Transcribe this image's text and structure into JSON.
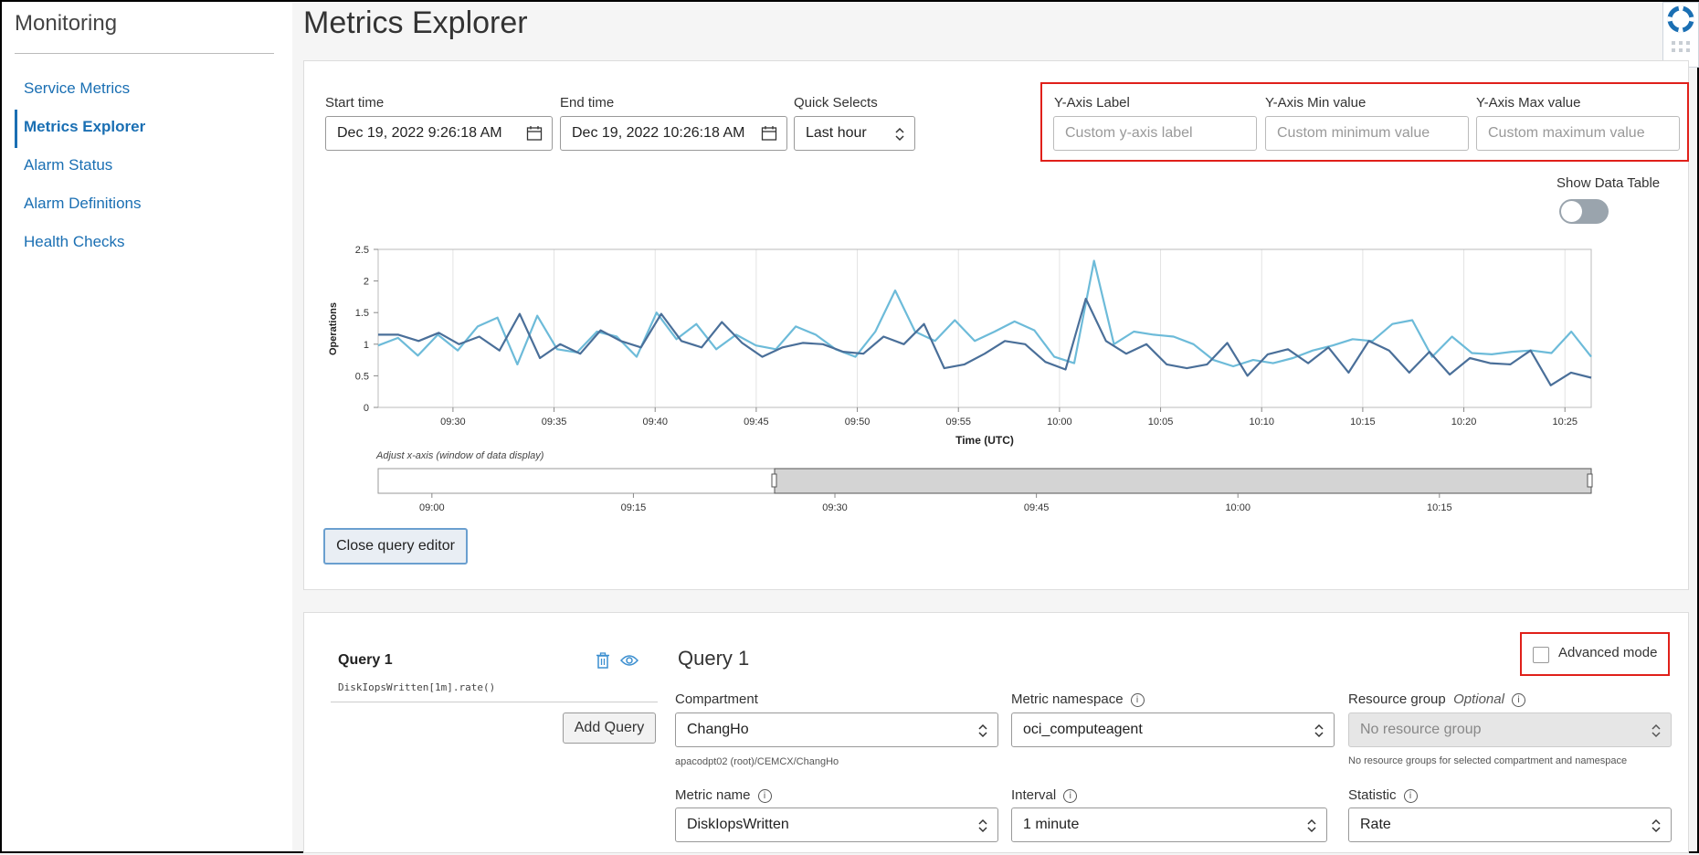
{
  "sidebar": {
    "title": "Monitoring",
    "items": [
      {
        "label": "Service Metrics",
        "active": false
      },
      {
        "label": "Metrics Explorer",
        "active": true
      },
      {
        "label": "Alarm Status",
        "active": false
      },
      {
        "label": "Alarm Definitions",
        "active": false
      },
      {
        "label": "Health Checks",
        "active": false
      }
    ]
  },
  "page_title": "Metrics Explorer",
  "time": {
    "start_label": "Start time",
    "start_value": "Dec 19, 2022 9:26:18 AM",
    "end_label": "End time",
    "end_value": "Dec 19, 2022 10:26:18 AM",
    "quick_label": "Quick Selects",
    "quick_value": "Last hour"
  },
  "yaxis": {
    "label_label": "Y-Axis Label",
    "label_placeholder": "Custom y-axis label",
    "min_label": "Y-Axis Min value",
    "min_placeholder": "Custom minimum value",
    "max_label": "Y-Axis Max value",
    "max_placeholder": "Custom maximum value"
  },
  "show_data_table": {
    "label": "Show Data Table",
    "on": false
  },
  "chart_data": {
    "type": "line",
    "ylabel": "Operations",
    "xlabel": "Time (UTC)",
    "ylim": [
      0,
      2.5
    ],
    "yticks": [
      "0",
      "0.5",
      "1",
      "1.5",
      "2",
      "2.5"
    ],
    "xticks": [
      "09:30",
      "09:35",
      "09:40",
      "09:45",
      "09:50",
      "09:55",
      "10:00",
      "10:05",
      "10:10",
      "10:15",
      "10:20",
      "10:25"
    ],
    "grid": true,
    "colors": [
      "#6dbbd9",
      "#4a6f99"
    ],
    "series": [
      {
        "values": [
          0.98,
          1.1,
          0.82,
          1.15,
          0.9,
          1.28,
          1.42,
          0.68,
          1.45,
          0.92,
          0.87,
          1.2,
          1.12,
          0.8,
          1.5,
          1.08,
          1.32,
          0.92,
          1.15,
          0.98,
          0.92,
          1.28,
          1.15,
          0.92,
          0.8,
          1.2,
          1.85,
          1.2,
          1.05,
          1.38,
          1.05,
          1.2,
          1.36,
          1.22,
          0.8,
          0.7,
          2.32,
          1.0,
          1.2,
          1.15,
          1.12,
          1.0,
          0.75,
          0.65,
          0.75,
          0.7,
          0.78,
          0.9,
          0.98,
          1.08,
          1.05,
          1.32,
          1.38,
          0.8,
          1.12,
          0.86,
          0.84,
          0.88,
          0.9,
          0.86,
          1.2,
          0.8
        ]
      },
      {
        "values": [
          1.15,
          1.15,
          1.05,
          1.18,
          1.0,
          1.12,
          0.9,
          1.48,
          0.78,
          1.0,
          0.85,
          1.22,
          1.05,
          0.95,
          1.48,
          1.05,
          0.95,
          1.35,
          1.02,
          0.8,
          0.95,
          1.02,
          1.0,
          0.88,
          0.85,
          1.12,
          1.0,
          1.32,
          0.62,
          0.68,
          0.85,
          1.05,
          1.0,
          0.72,
          0.6,
          1.72,
          1.05,
          0.85,
          1.0,
          0.68,
          0.62,
          0.68,
          1.02,
          0.5,
          0.84,
          0.92,
          0.7,
          0.95,
          0.55,
          1.05,
          0.9,
          0.55,
          0.88,
          0.52,
          0.78,
          0.7,
          0.68,
          0.9,
          0.35,
          0.55,
          0.47
        ]
      }
    ]
  },
  "range_slider": {
    "caption": "Adjust x-axis (window of data display)",
    "ticks": [
      "09:00",
      "09:15",
      "09:30",
      "09:45",
      "10:00",
      "10:15"
    ]
  },
  "close_editor_label": "Close query editor",
  "query": {
    "sidebar_title": "Query 1",
    "expression": "DiskIopsWritten[1m].rate()",
    "add_query_label": "Add Query",
    "title": "Query 1",
    "advanced_mode_label": "Advanced mode",
    "advanced_mode_checked": false,
    "compartment_label": "Compartment",
    "compartment_value": "ChangHo",
    "compartment_path": "apacodpt02 (root)/CEMCX/ChangHo",
    "namespace_label": "Metric namespace",
    "namespace_value": "oci_computeagent",
    "resource_group_label": "Resource group",
    "resource_group_optional": "Optional",
    "resource_group_value": "No resource group",
    "resource_group_helper": "No resource groups for selected compartment and namespace",
    "metric_name_label": "Metric name",
    "metric_name_value": "DiskIopsWritten",
    "interval_label": "Interval",
    "interval_value": "1 minute",
    "statistic_label": "Statistic",
    "statistic_value": "Rate"
  },
  "icons": {
    "calendar": "calendar-icon",
    "updown": "updown-chevron-icon",
    "trash": "trash-icon",
    "eye": "eye-icon",
    "info": "info-icon",
    "help": "lifebuoy-icon"
  }
}
